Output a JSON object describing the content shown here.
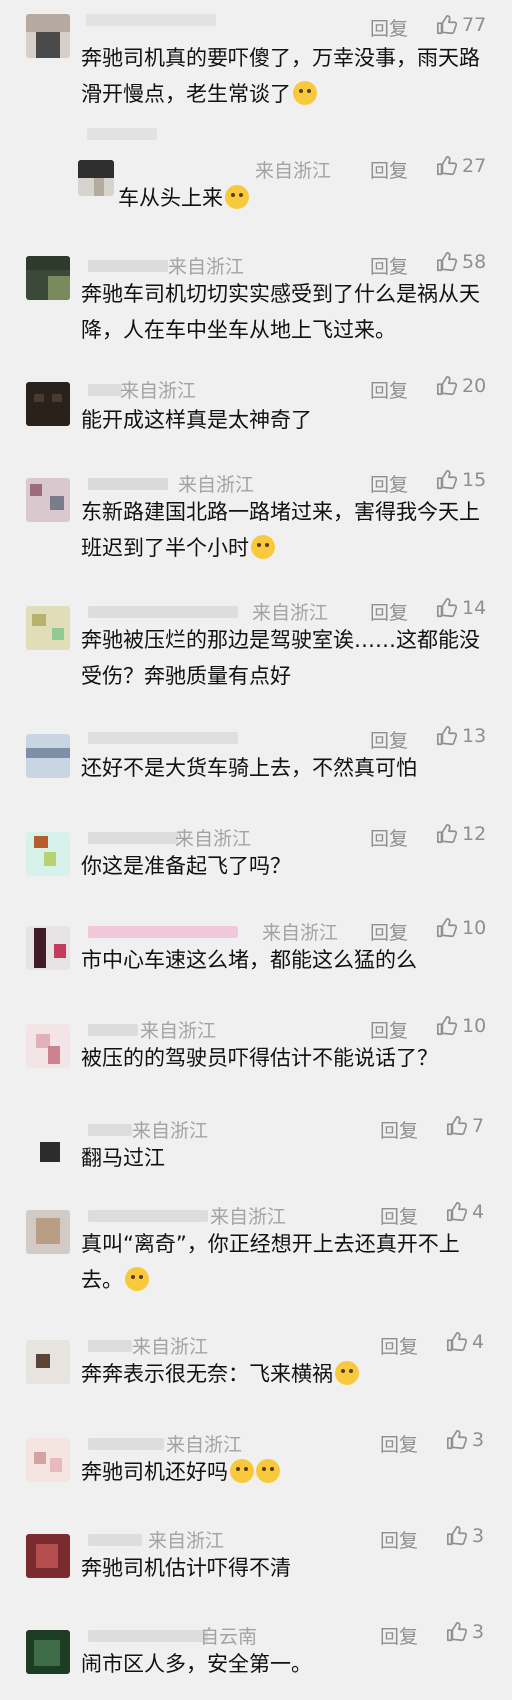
{
  "labels": {
    "reply": "回复"
  },
  "comments": [
    {
      "location": "",
      "likes": "77",
      "text": "奔驰司机真的要吓傻了，万幸没事，雨天路滑开慢点，老生常谈了",
      "emoji": "😂"
    },
    {
      "location": "来自浙江",
      "likes": "27",
      "text": "车从头上来",
      "emoji": "😭"
    },
    {
      "location": "来自浙江",
      "likes": "58",
      "text": "奔驰车司机切切实实感受到了什么是祸从天降，人在车中坐车从地上飞过来。",
      "emoji": ""
    },
    {
      "location": "来自浙江",
      "likes": "20",
      "text": "能开成这样真是太神奇了",
      "emoji": ""
    },
    {
      "location": "来自浙江",
      "likes": "15",
      "text": "东新路建国北路一路堵过来，害得我今天上班迟到了半个小时",
      "emoji": "😣"
    },
    {
      "location": "来自浙江",
      "likes": "14",
      "text": "奔驰被压烂的那边是驾驶室诶……这都能没受伤？奔驰质量有点好",
      "emoji": ""
    },
    {
      "location": "",
      "likes": "13",
      "text": "还好不是大货车骑上去，不然真可怕",
      "emoji": ""
    },
    {
      "location": "来自浙江",
      "likes": "12",
      "text": "你这是准备起飞了吗？",
      "emoji": ""
    },
    {
      "location": "来自浙江",
      "likes": "10",
      "text": "市中心车速这么堵，都能这么猛的么",
      "emoji": ""
    },
    {
      "location": "来自浙江",
      "likes": "10",
      "text": "被压的的驾驶员吓得估计不能说话了？",
      "emoji": ""
    },
    {
      "location": "来自浙江",
      "likes": "7",
      "text": "翻马过江",
      "emoji": ""
    },
    {
      "location": "来自浙江",
      "likes": "4",
      "text": "真叫“离奇”，你正经想开上去还真开不上去。",
      "emoji": "😮"
    },
    {
      "location": "来自浙江",
      "likes": "4",
      "text": "奔奔表示很无奈：飞来横祸",
      "emoji": "😳"
    },
    {
      "location": "来自浙江",
      "likes": "3",
      "text": "奔驰司机还好吗",
      "emoji": "😳😳"
    },
    {
      "location": "来自浙江",
      "likes": "3",
      "text": "奔驰司机估计吓得不清",
      "emoji": ""
    },
    {
      "location": "自云南",
      "likes": "3",
      "text": "闹市区人多，安全第一。",
      "emoji": ""
    }
  ]
}
